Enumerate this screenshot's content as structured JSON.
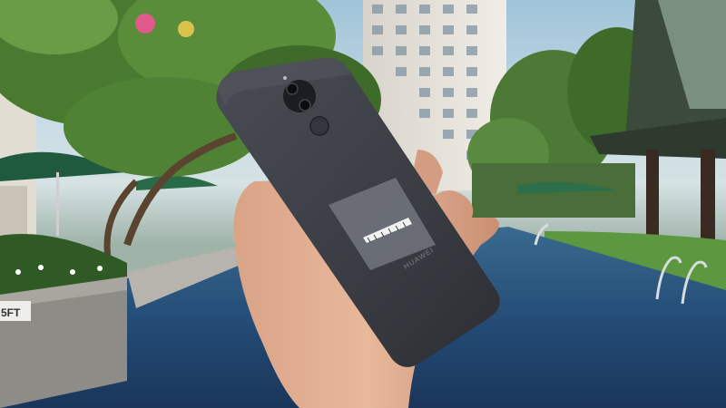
{
  "scene": {
    "description_labels": {
      "phone_brand": "HUAWEI",
      "sign_text": "5FT"
    },
    "colors": {
      "phone_body": "#3b3d44",
      "pool_water": "#2c4f7a",
      "foliage": "#3f6b2a",
      "building": "#e6e3dc"
    }
  }
}
